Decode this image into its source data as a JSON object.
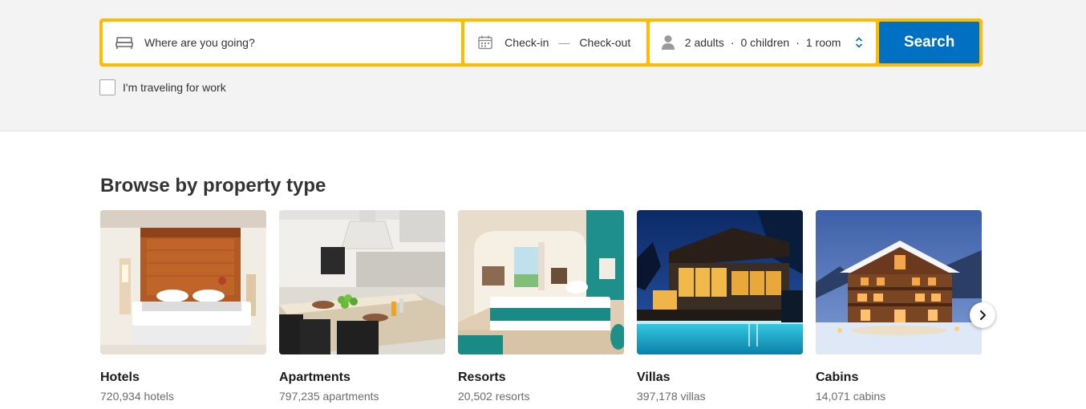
{
  "search": {
    "destination_placeholder": "Where are you going?",
    "checkin": "Check-in",
    "checkout": "Check-out",
    "adults": "2 adults",
    "children": "0 children",
    "rooms": "1 room",
    "button": "Search",
    "work_label": "I'm traveling for work",
    "work_checked": false,
    "icons": [
      "bed-icon",
      "calendar-icon",
      "person-icon",
      "up-down-arrows-icon"
    ]
  },
  "browse": {
    "title": "Browse by property type",
    "cards": [
      {
        "name": "Hotels",
        "count": "720,934 hotels"
      },
      {
        "name": "Apartments",
        "count": "797,235 apartments"
      },
      {
        "name": "Resorts",
        "count": "20,502 resorts"
      },
      {
        "name": "Villas",
        "count": "397,178 villas"
      },
      {
        "name": "Cabins",
        "count": "14,071 cabins"
      }
    ]
  },
  "colors": {
    "brand_yellow": "#febb02",
    "brand_blue": "#0071c2"
  }
}
